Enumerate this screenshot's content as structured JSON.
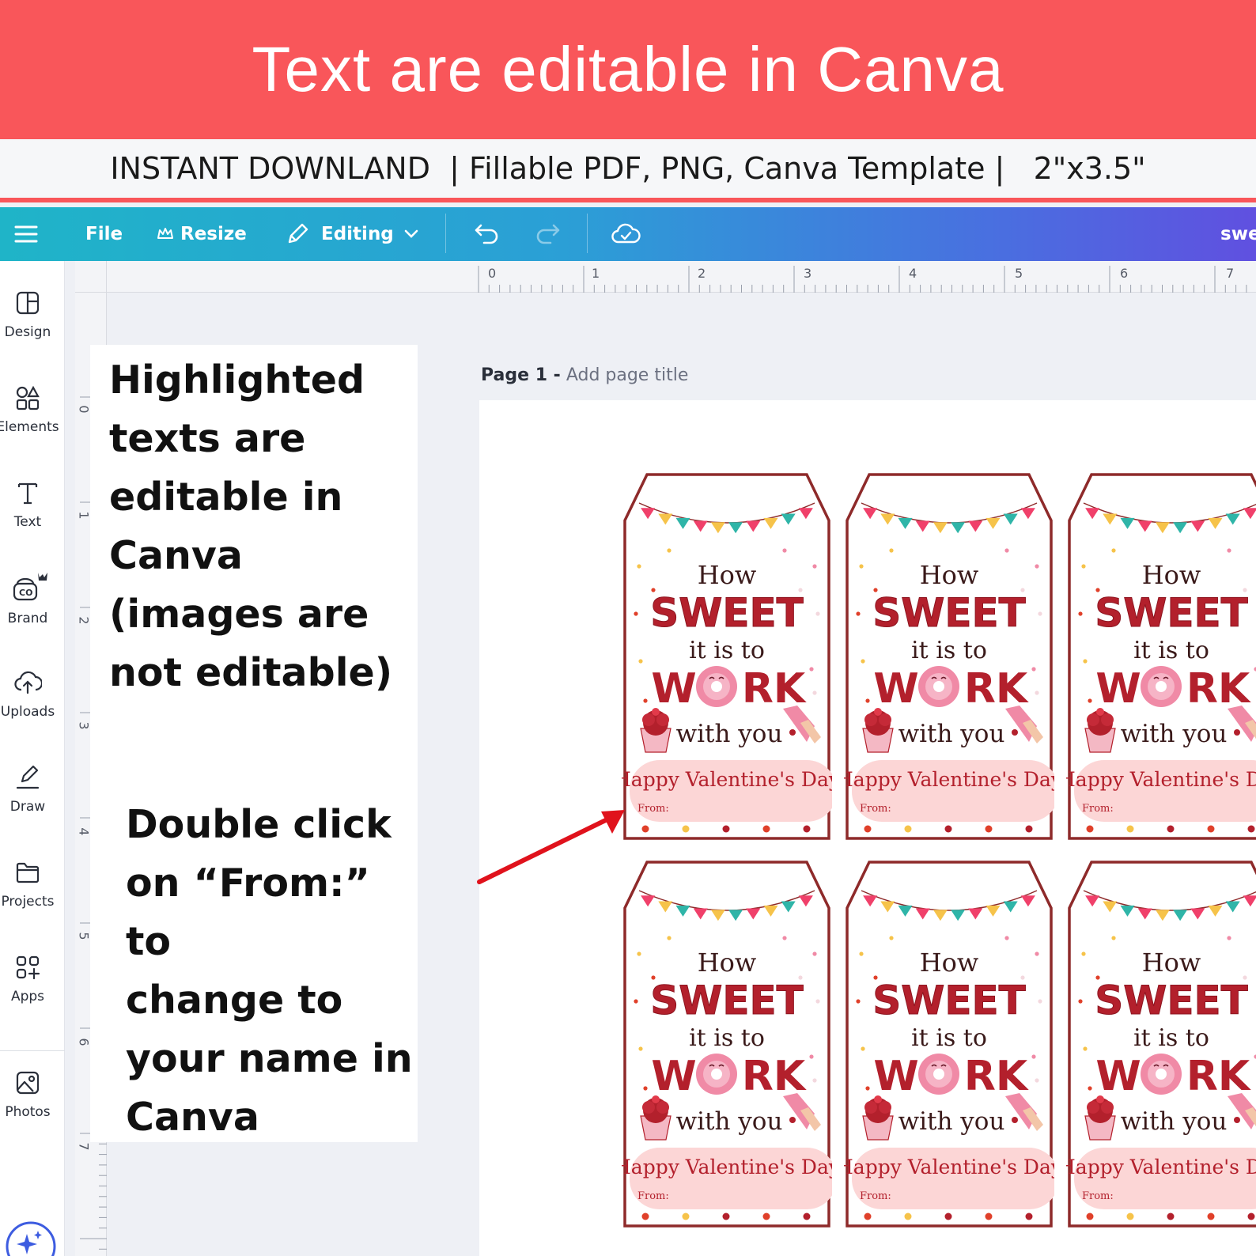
{
  "banner": {
    "title": "Text are editable in Canva"
  },
  "info_strip": {
    "text": "INSTANT DOWNLAND  | Fillable PDF, PNG, Canva Template |   2\"x3.5\""
  },
  "toolbar": {
    "file_label": "File",
    "resize_label": "Resize",
    "editing_label": "Editing",
    "doc_title_partial": "swe"
  },
  "sidebar": {
    "items": [
      {
        "label": "Design",
        "icon": "design-icon"
      },
      {
        "label": "Elements",
        "icon": "elements-icon"
      },
      {
        "label": "Text",
        "icon": "text-icon"
      },
      {
        "label": "Brand",
        "icon": "brand-icon"
      },
      {
        "label": "Uploads",
        "icon": "uploads-icon"
      },
      {
        "label": "Draw",
        "icon": "draw-icon"
      },
      {
        "label": "Projects",
        "icon": "projects-icon"
      },
      {
        "label": "Apps",
        "icon": "apps-icon"
      },
      {
        "label": "Photos",
        "icon": "photos-icon"
      }
    ]
  },
  "ruler": {
    "top": [
      "0",
      "1",
      "2",
      "3",
      "4",
      "5",
      "6",
      "7"
    ],
    "left": [
      "0",
      "1",
      "2",
      "3",
      "4",
      "5",
      "6",
      "7"
    ]
  },
  "note": {
    "lines1": [
      "Highlighted",
      "texts are",
      "editable in",
      "Canva",
      "(images are",
      "not editable)"
    ],
    "lines2": [
      "Double click",
      "on “From:” to",
      "change to",
      "your name in",
      "Canva"
    ]
  },
  "page": {
    "number_label": "Page 1 -",
    "title_placeholder": "Add page title"
  },
  "tag": {
    "line1": "How",
    "line2": "SWEET",
    "line3": "it is to",
    "line4a": "W",
    "line4b": "RK",
    "line5": "with you",
    "greeting": "Happy Valentine's Day",
    "from": "From:"
  },
  "colors": {
    "banner": "#f9565a",
    "tag_red": "#b3202c",
    "tag_border": "#8e2a2a",
    "from_bubble": "#fcd6d6"
  }
}
